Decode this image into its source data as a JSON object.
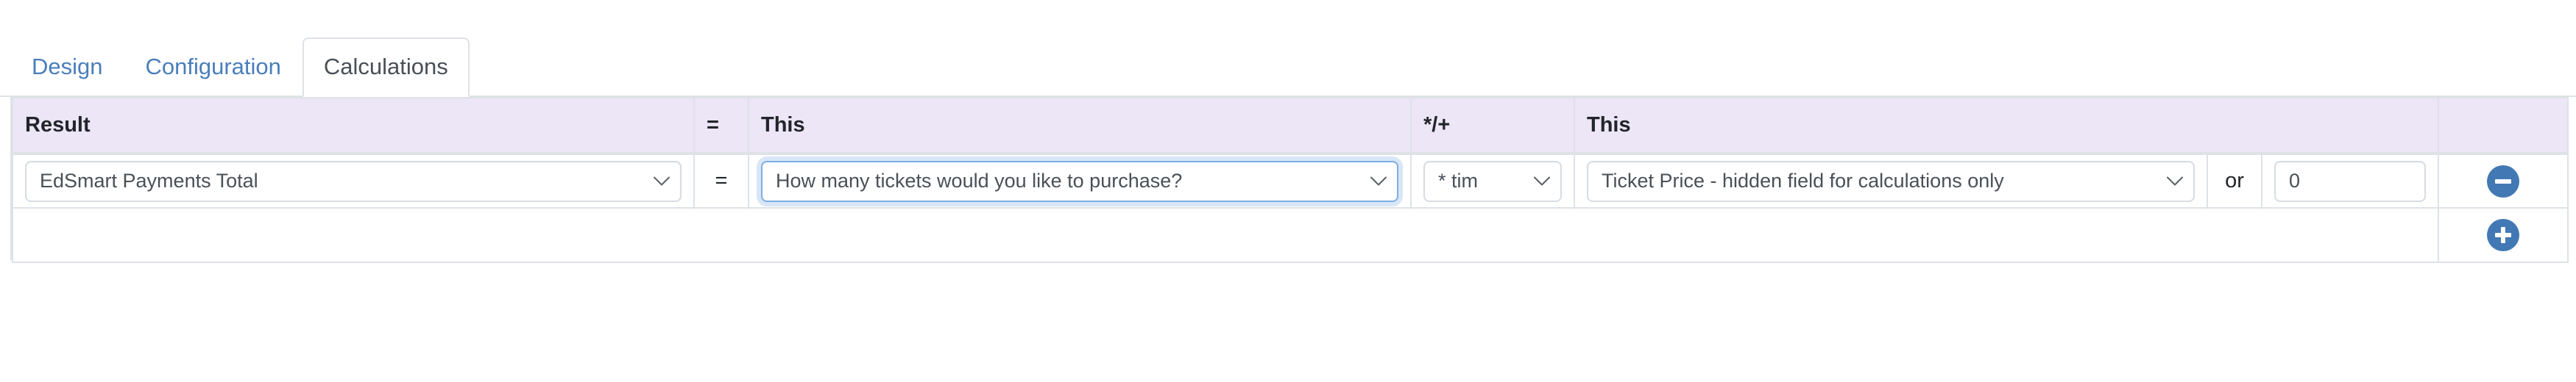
{
  "tabs": [
    {
      "label": "Design",
      "active": false
    },
    {
      "label": "Configuration",
      "active": false
    },
    {
      "label": "Calculations",
      "active": true
    }
  ],
  "table": {
    "headers": {
      "result": "Result",
      "equals": "=",
      "this_left": "This",
      "operator": "*/+",
      "this_right": "This",
      "actions": ""
    },
    "rows": [
      {
        "result_select": "EdSmart Payments Total",
        "equals_symbol": "=",
        "this_left_select": "How many tickets would you like to purchase?",
        "operator_select": "* tim",
        "this_right_select": "Ticket Price - hidden field for calculations only",
        "or_label": "or",
        "constant_value": "0",
        "remove_icon": "minus-circle-icon"
      }
    ],
    "add_row": {
      "add_icon": "plus-circle-icon"
    }
  },
  "colors": {
    "header_bg": "#ece6f7",
    "tab_link": "#4a7ebb",
    "tab_active_text": "#495057",
    "border": "#dee2e6",
    "button_blue": "#4279b4",
    "focus_ring": "#7dade4"
  }
}
